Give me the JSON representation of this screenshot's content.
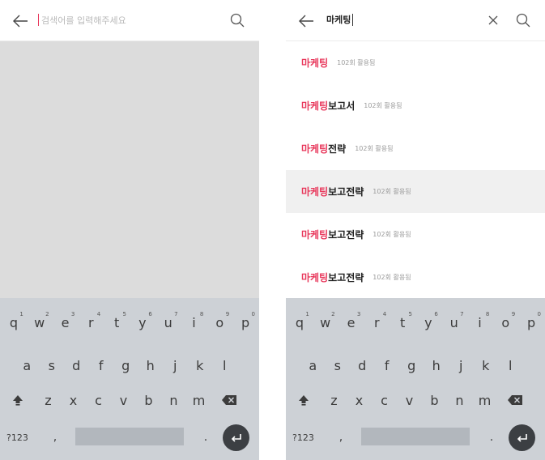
{
  "left_screen": {
    "search": {
      "placeholder": "검색어를 입력해주세요"
    }
  },
  "right_screen": {
    "search": {
      "query": "마케팅"
    },
    "suggestions": [
      {
        "match": "마케팅",
        "rest": "",
        "usage": "102회 활용됨",
        "active": false
      },
      {
        "match": "마케팅",
        "rest": "보고서",
        "usage": "102회 활용됨",
        "active": false
      },
      {
        "match": "마케팅",
        "rest": "전략",
        "usage": "102회 활용됨",
        "active": false
      },
      {
        "match": "마케팅",
        "rest": "보고전략",
        "usage": "102회 활용됨",
        "active": true
      },
      {
        "match": "마케팅",
        "rest": "보고전략",
        "usage": "102회 활용됨",
        "active": false
      },
      {
        "match": "마케팅",
        "rest": "보고전략",
        "usage": "102회 활용됨",
        "active": false
      }
    ]
  },
  "keyboard": {
    "row1": [
      {
        "key": "q",
        "hint": "1"
      },
      {
        "key": "w",
        "hint": "2"
      },
      {
        "key": "e",
        "hint": "3"
      },
      {
        "key": "r",
        "hint": "4"
      },
      {
        "key": "t",
        "hint": "5"
      },
      {
        "key": "y",
        "hint": "6"
      },
      {
        "key": "u",
        "hint": "7"
      },
      {
        "key": "i",
        "hint": "8"
      },
      {
        "key": "o",
        "hint": "9"
      },
      {
        "key": "p",
        "hint": "0"
      }
    ],
    "row2": [
      "a",
      "s",
      "d",
      "f",
      "g",
      "h",
      "j",
      "k",
      "l"
    ],
    "row3": [
      "z",
      "x",
      "c",
      "v",
      "b",
      "n",
      "m"
    ],
    "symbols_label": "?123",
    "comma": ",",
    "period": ".",
    "shift_icon": "shift-icon",
    "delete_icon": "backspace-icon",
    "enter_icon": "enter-icon"
  },
  "colors": {
    "accent": "#e8365a",
    "keyboard_bg": "#cdd1d6",
    "empty_bg": "#dcdcdc",
    "active_row": "#f0f0f0"
  }
}
